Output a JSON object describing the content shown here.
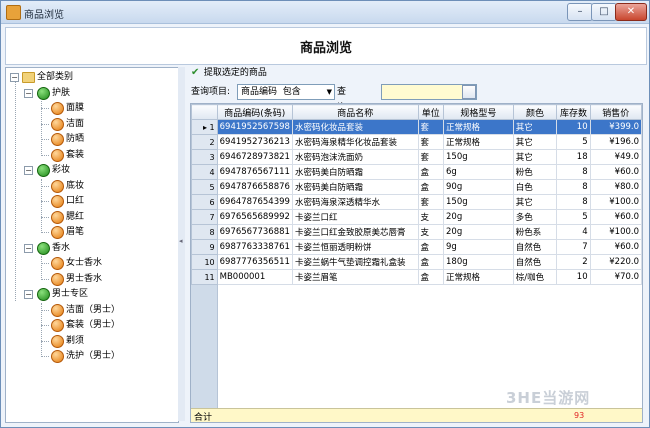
{
  "window": {
    "title": "商品浏览",
    "min": "–",
    "max": "□",
    "close": "✕"
  },
  "page": {
    "title": "商品浏览"
  },
  "toolbar": {
    "fetch_label": "提取选定的商品"
  },
  "query": {
    "field_label": "查询项目:",
    "field_value": "商品编码",
    "op_value": "包含",
    "content_label": "查询内容:",
    "content_value": ""
  },
  "tree": {
    "root": "全部类别",
    "groups": [
      {
        "label": "护肤",
        "items": [
          "面膜",
          "洁面",
          "防晒",
          "套装"
        ]
      },
      {
        "label": "彩妆",
        "items": [
          "底妆",
          "口红",
          "腮红",
          "眉笔"
        ]
      },
      {
        "label": "香水",
        "items": [
          "女士香水",
          "男士香水"
        ]
      },
      {
        "label": "男士专区",
        "items": [
          "洁面（男士）",
          "套装（男士）",
          "剃须",
          "洗护（男士）"
        ]
      }
    ]
  },
  "grid": {
    "columns": [
      "商品编码(条码)",
      "商品名称",
      "单位",
      "规格型号",
      "颜色",
      "库存数",
      "销售价"
    ],
    "rows": [
      [
        "6941952567598",
        "水密码化妆品套装",
        "套",
        "正常规格",
        "其它",
        "10",
        "¥399.0"
      ],
      [
        "6941952736213",
        "水密码海泉精华化妆品套装",
        "套",
        "正常规格",
        "其它",
        "5",
        "¥196.0"
      ],
      [
        "6946728973821",
        "水密码泡沫洗面奶",
        "套",
        "150g",
        "其它",
        "18",
        "¥49.0"
      ],
      [
        "6947876567111",
        "水密码美白防晒霜",
        "盒",
        "6g",
        "粉色",
        "8",
        "¥60.0"
      ],
      [
        "6947876658876",
        "水密码美白防晒霜",
        "盒",
        "90g",
        "白色",
        "8",
        "¥80.0"
      ],
      [
        "6964787654399",
        "水密码海泉深透精华水",
        "套",
        "150g",
        "其它",
        "8",
        "¥100.0"
      ],
      [
        "6976565689992",
        "卡姿兰口红",
        "支",
        "20g",
        "多色",
        "5",
        "¥60.0"
      ],
      [
        "6976567736881",
        "卡姿兰口红金致胶原美芯唇膏",
        "支",
        "20g",
        "粉色系",
        "4",
        "¥100.0"
      ],
      [
        "6987763338761",
        "卡姿兰恒丽透明粉饼",
        "盒",
        "9g",
        "自然色",
        "7",
        "¥60.0"
      ],
      [
        "6987776356511",
        "卡姿兰蜗牛气垫调控霜礼盒装",
        "盒",
        "180g",
        "自然色",
        "2",
        "¥220.0"
      ],
      [
        "MB000001",
        "卡姿兰眉笔",
        "盒",
        "正常规格",
        "棕/咖色",
        "10",
        "¥70.0"
      ]
    ],
    "selected_row": 0,
    "total_label": "合计",
    "total_stock": "93"
  },
  "watermark": "3HE当游网"
}
